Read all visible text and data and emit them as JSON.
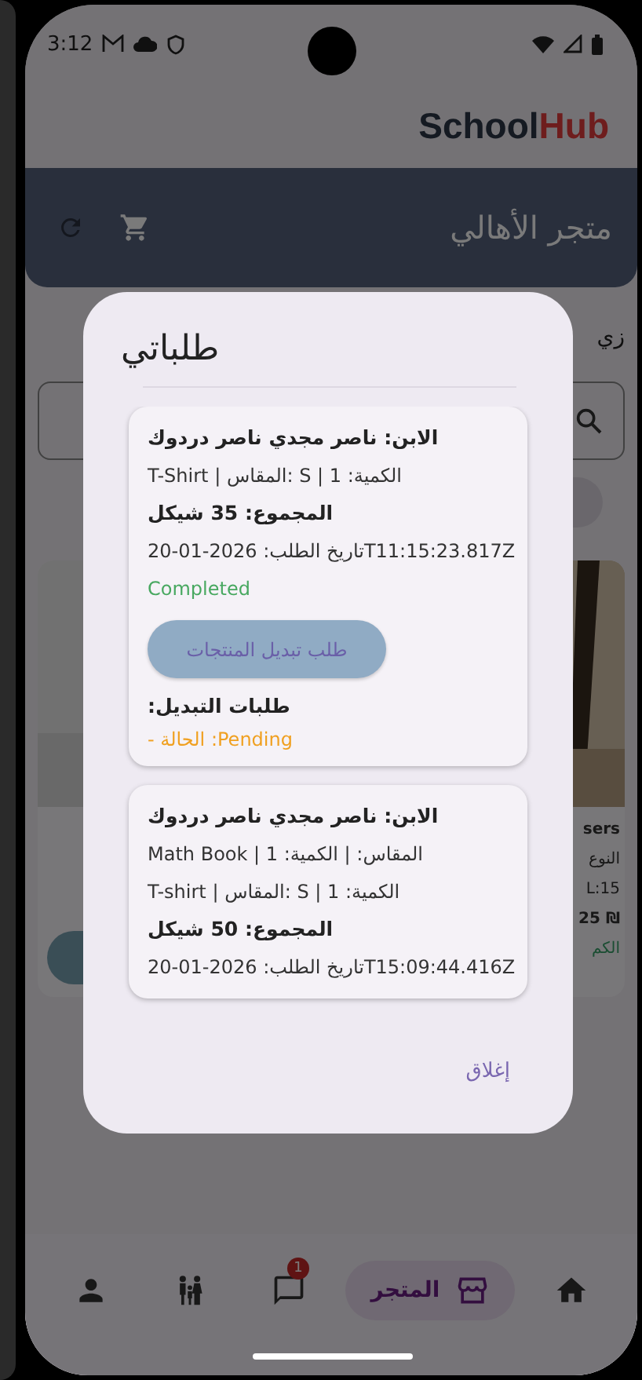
{
  "status_bar": {
    "time": "3:12"
  },
  "logo": {
    "part_1": "School",
    "part_2": "Hub"
  },
  "header": {
    "title": "متجر الأهالي"
  },
  "background": {
    "section_label": "زي",
    "product_texts": [
      {
        "text": "sers",
        "kind": "name"
      },
      {
        "text": "النوع",
        "kind": "detail"
      },
      {
        "text": "L:15",
        "kind": "detail"
      },
      {
        "text": "25 ₪",
        "kind": "price"
      },
      {
        "text": "الكم",
        "kind": "stock"
      }
    ]
  },
  "dialog": {
    "title": "طلباتي",
    "orders": [
      {
        "child": "الابن: ناصر مجدي ناصر دردوك",
        "items": [
          "T-Shirt | المقاس: S | الكمية: 1"
        ],
        "total": "المجموع: 35 شيكل",
        "date": "تاريخ الطلب: 2026-01-20T11:15:23.817Z",
        "status": {
          "text": "Completed",
          "kind": "completed"
        },
        "exchange_button": {
          "label": "طلب تبديل المنتجات",
          "disabled": true
        },
        "exchange_heading": ":طلبات التبديل",
        "exchange_requests": [
          {
            "text": "- الحالة :Pending",
            "kind": "pending"
          }
        ]
      },
      {
        "child": "الابن: ناصر مجدي ناصر دردوك",
        "items": [
          "Math Book | المقاس:  | الكمية: 1",
          "T-shirt | المقاس: S | الكمية: 1"
        ],
        "total": "المجموع: 50 شيكل",
        "date": "تاريخ الطلب: 2026-01-20T15:09:44.416Z"
      }
    ],
    "close_button": "إغلاق"
  },
  "bottom_nav": [
    {
      "kind": "home",
      "selected": false
    },
    {
      "kind": "store",
      "label": "المتجر",
      "selected": true
    },
    {
      "kind": "chat",
      "badge": "1",
      "selected": false
    },
    {
      "kind": "family",
      "selected": false
    },
    {
      "kind": "profile",
      "selected": false
    }
  ]
}
